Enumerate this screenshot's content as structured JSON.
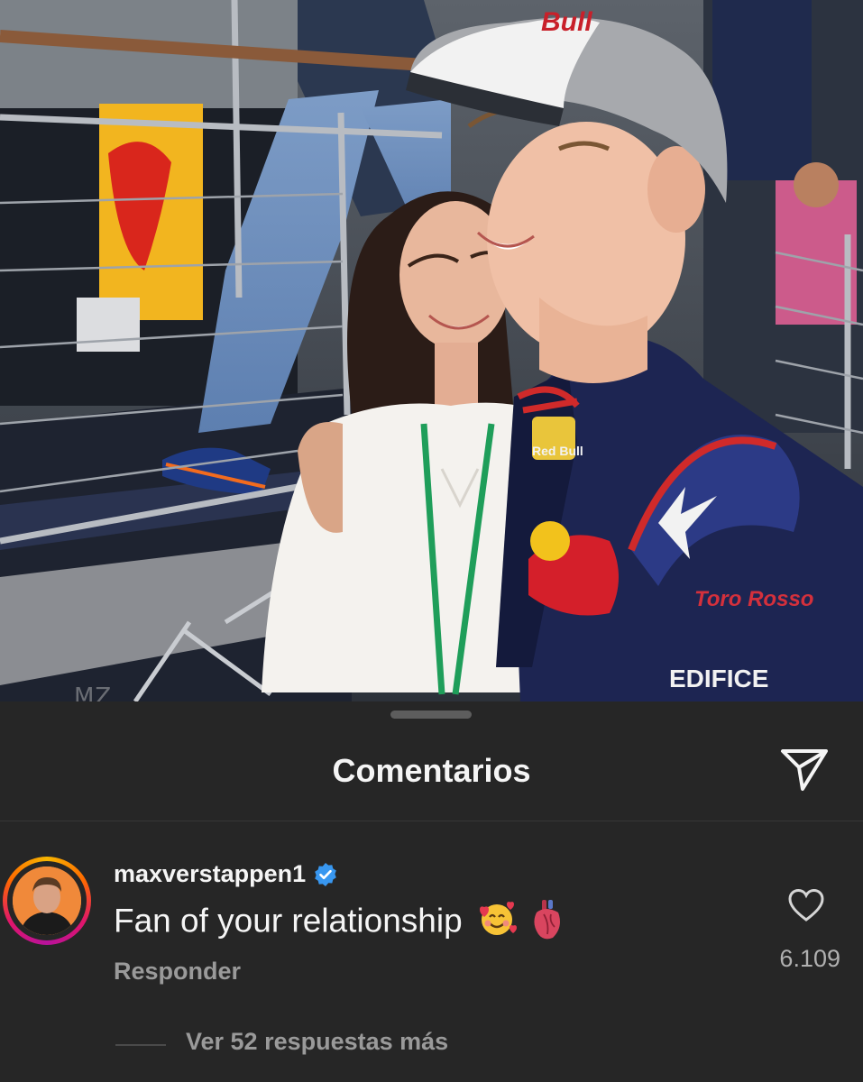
{
  "photo": {
    "watermark": "MZ",
    "cap_logo": "Bull",
    "suit_logo_1": "Red Bull",
    "suit_logo_2": "Toro Rosso",
    "suit_logo_3": "EDIFICE"
  },
  "sheet": {
    "title": "Comentarios"
  },
  "comment": {
    "username": "maxverstappen1",
    "verified": true,
    "text": "Fan of your relationship",
    "emojis": [
      "smiling-face-with-hearts-emoji",
      "anatomical-heart-emoji"
    ],
    "reply_label": "Responder",
    "like_count": "6.109",
    "view_replies_label": "Ver 52 respuestas más"
  },
  "colors": {
    "background": "#262626",
    "verified_badge": "#3897f0",
    "secondary_text": "#9a9a9a"
  }
}
